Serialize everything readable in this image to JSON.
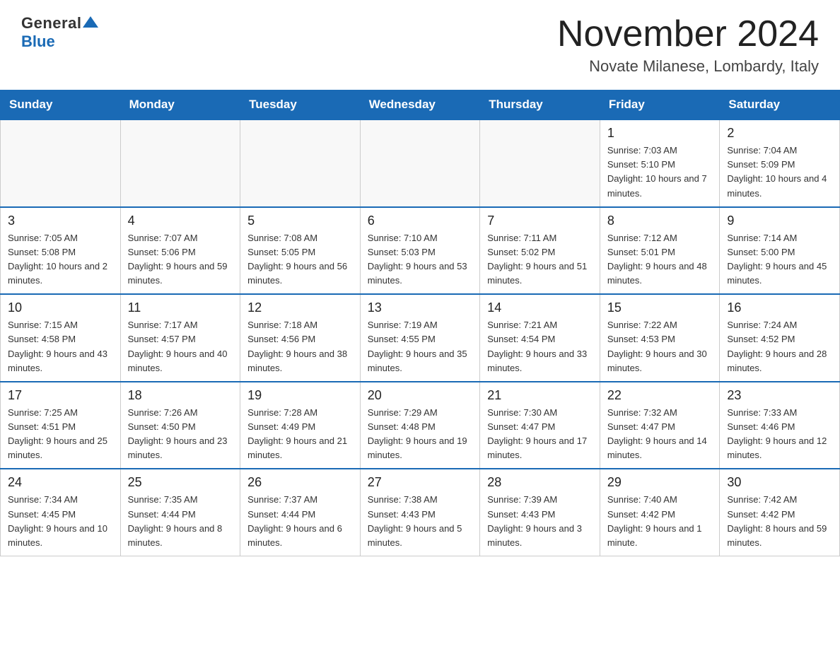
{
  "header": {
    "logo_general": "General",
    "logo_blue": "Blue",
    "month_title": "November 2024",
    "location": "Novate Milanese, Lombardy, Italy"
  },
  "weekdays": [
    "Sunday",
    "Monday",
    "Tuesday",
    "Wednesday",
    "Thursday",
    "Friday",
    "Saturday"
  ],
  "weeks": [
    [
      {
        "day": "",
        "info": ""
      },
      {
        "day": "",
        "info": ""
      },
      {
        "day": "",
        "info": ""
      },
      {
        "day": "",
        "info": ""
      },
      {
        "day": "",
        "info": ""
      },
      {
        "day": "1",
        "info": "Sunrise: 7:03 AM\nSunset: 5:10 PM\nDaylight: 10 hours and 7 minutes."
      },
      {
        "day": "2",
        "info": "Sunrise: 7:04 AM\nSunset: 5:09 PM\nDaylight: 10 hours and 4 minutes."
      }
    ],
    [
      {
        "day": "3",
        "info": "Sunrise: 7:05 AM\nSunset: 5:08 PM\nDaylight: 10 hours and 2 minutes."
      },
      {
        "day": "4",
        "info": "Sunrise: 7:07 AM\nSunset: 5:06 PM\nDaylight: 9 hours and 59 minutes."
      },
      {
        "day": "5",
        "info": "Sunrise: 7:08 AM\nSunset: 5:05 PM\nDaylight: 9 hours and 56 minutes."
      },
      {
        "day": "6",
        "info": "Sunrise: 7:10 AM\nSunset: 5:03 PM\nDaylight: 9 hours and 53 minutes."
      },
      {
        "day": "7",
        "info": "Sunrise: 7:11 AM\nSunset: 5:02 PM\nDaylight: 9 hours and 51 minutes."
      },
      {
        "day": "8",
        "info": "Sunrise: 7:12 AM\nSunset: 5:01 PM\nDaylight: 9 hours and 48 minutes."
      },
      {
        "day": "9",
        "info": "Sunrise: 7:14 AM\nSunset: 5:00 PM\nDaylight: 9 hours and 45 minutes."
      }
    ],
    [
      {
        "day": "10",
        "info": "Sunrise: 7:15 AM\nSunset: 4:58 PM\nDaylight: 9 hours and 43 minutes."
      },
      {
        "day": "11",
        "info": "Sunrise: 7:17 AM\nSunset: 4:57 PM\nDaylight: 9 hours and 40 minutes."
      },
      {
        "day": "12",
        "info": "Sunrise: 7:18 AM\nSunset: 4:56 PM\nDaylight: 9 hours and 38 minutes."
      },
      {
        "day": "13",
        "info": "Sunrise: 7:19 AM\nSunset: 4:55 PM\nDaylight: 9 hours and 35 minutes."
      },
      {
        "day": "14",
        "info": "Sunrise: 7:21 AM\nSunset: 4:54 PM\nDaylight: 9 hours and 33 minutes."
      },
      {
        "day": "15",
        "info": "Sunrise: 7:22 AM\nSunset: 4:53 PM\nDaylight: 9 hours and 30 minutes."
      },
      {
        "day": "16",
        "info": "Sunrise: 7:24 AM\nSunset: 4:52 PM\nDaylight: 9 hours and 28 minutes."
      }
    ],
    [
      {
        "day": "17",
        "info": "Sunrise: 7:25 AM\nSunset: 4:51 PM\nDaylight: 9 hours and 25 minutes."
      },
      {
        "day": "18",
        "info": "Sunrise: 7:26 AM\nSunset: 4:50 PM\nDaylight: 9 hours and 23 minutes."
      },
      {
        "day": "19",
        "info": "Sunrise: 7:28 AM\nSunset: 4:49 PM\nDaylight: 9 hours and 21 minutes."
      },
      {
        "day": "20",
        "info": "Sunrise: 7:29 AM\nSunset: 4:48 PM\nDaylight: 9 hours and 19 minutes."
      },
      {
        "day": "21",
        "info": "Sunrise: 7:30 AM\nSunset: 4:47 PM\nDaylight: 9 hours and 17 minutes."
      },
      {
        "day": "22",
        "info": "Sunrise: 7:32 AM\nSunset: 4:47 PM\nDaylight: 9 hours and 14 minutes."
      },
      {
        "day": "23",
        "info": "Sunrise: 7:33 AM\nSunset: 4:46 PM\nDaylight: 9 hours and 12 minutes."
      }
    ],
    [
      {
        "day": "24",
        "info": "Sunrise: 7:34 AM\nSunset: 4:45 PM\nDaylight: 9 hours and 10 minutes."
      },
      {
        "day": "25",
        "info": "Sunrise: 7:35 AM\nSunset: 4:44 PM\nDaylight: 9 hours and 8 minutes."
      },
      {
        "day": "26",
        "info": "Sunrise: 7:37 AM\nSunset: 4:44 PM\nDaylight: 9 hours and 6 minutes."
      },
      {
        "day": "27",
        "info": "Sunrise: 7:38 AM\nSunset: 4:43 PM\nDaylight: 9 hours and 5 minutes."
      },
      {
        "day": "28",
        "info": "Sunrise: 7:39 AM\nSunset: 4:43 PM\nDaylight: 9 hours and 3 minutes."
      },
      {
        "day": "29",
        "info": "Sunrise: 7:40 AM\nSunset: 4:42 PM\nDaylight: 9 hours and 1 minute."
      },
      {
        "day": "30",
        "info": "Sunrise: 7:42 AM\nSunset: 4:42 PM\nDaylight: 8 hours and 59 minutes."
      }
    ]
  ]
}
